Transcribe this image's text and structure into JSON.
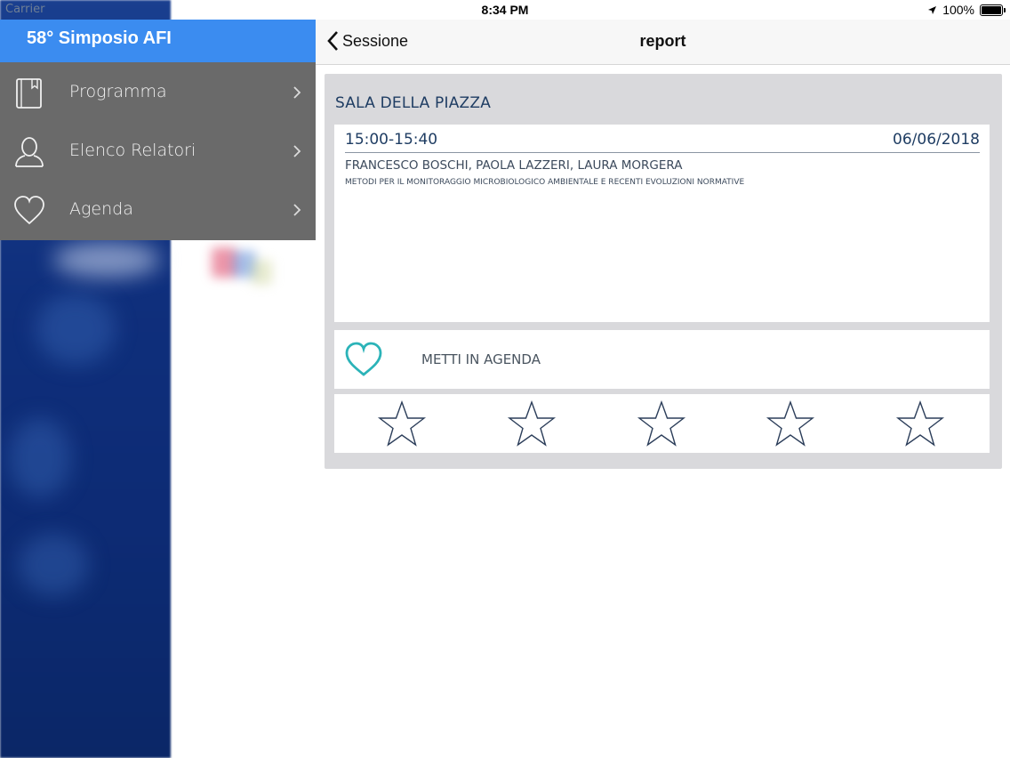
{
  "status_bar": {
    "carrier": "Carrier",
    "time": "8:34 PM",
    "battery": "100%"
  },
  "side_menu": {
    "title": "58° Simposio AFI",
    "header_color": "#3b8cf0",
    "panel_color": "#6a6a6a",
    "items": [
      {
        "label": "Programma",
        "icon": "book-icon"
      },
      {
        "label": "Elenco Relatori",
        "icon": "person-icon"
      },
      {
        "label": "Agenda",
        "icon": "heart-icon"
      }
    ]
  },
  "nav": {
    "back_label": "Sessione",
    "title": "report"
  },
  "session": {
    "room": "SALA DELLA PIAZZA",
    "time": "15:00-15:40",
    "date": "06/06/2018",
    "speakers": "FRANCESCO BOSCHI, PAOLA LAZZERI, LAURA MORGERA",
    "subject": "METODI PER IL MONITORAGGIO MICROBIOLOGICO AMBIENTALE E RECENTI EVOLUZIONI NORMATIVE",
    "agenda_label": "METTI IN AGENDA",
    "accent_color": "#2bb3b8",
    "text_color": "#1f3d63"
  },
  "rating": {
    "max_stars": 5,
    "selected": 0
  }
}
